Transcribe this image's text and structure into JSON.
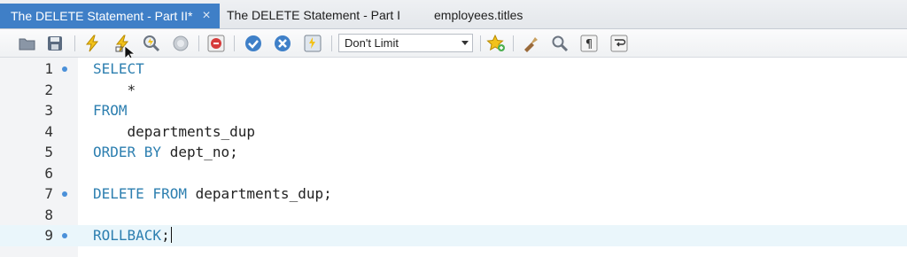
{
  "tabs": [
    {
      "label": "The DELETE Statement - Part II*",
      "active": true,
      "closable": true
    },
    {
      "label": "The DELETE Statement - Part I",
      "active": false,
      "closable": false
    },
    {
      "label": "employees.titles",
      "active": false,
      "closable": false
    }
  ],
  "toolbar": {
    "icons": [
      "open-folder-icon",
      "save-icon",
      "execute-icon",
      "execute-current-icon",
      "explain-icon",
      "stop-icon",
      "toggle-error-icon",
      "commit-icon",
      "rollback-icon",
      "autocommit-icon",
      "favorite-add-icon",
      "beautify-icon",
      "find-icon",
      "invisible-chars-icon",
      "wrap-icon"
    ],
    "limit_value": "Don't Limit"
  },
  "editor": {
    "lines": [
      {
        "num": "1",
        "marker": true,
        "kw": "SELECT",
        "text": ""
      },
      {
        "num": "2",
        "marker": false,
        "kw": "",
        "text": "    *"
      },
      {
        "num": "3",
        "marker": false,
        "kw": "FROM",
        "text": ""
      },
      {
        "num": "4",
        "marker": false,
        "kw": "",
        "text": "    departments_dup"
      },
      {
        "num": "5",
        "marker": false,
        "kw": "ORDER BY",
        "text": " dept_no;"
      },
      {
        "num": "6",
        "marker": false,
        "kw": "",
        "text": ""
      },
      {
        "num": "7",
        "marker": true,
        "kw": "DELETE FROM",
        "text": " departments_dup;"
      },
      {
        "num": "8",
        "marker": false,
        "kw": "",
        "text": ""
      },
      {
        "num": "9",
        "marker": true,
        "kw": "ROLLBACK",
        "text": ";",
        "current": true
      }
    ],
    "keyword_color": "#2d7fb0",
    "gutter_marker_color": "#4a90d9"
  },
  "colors": {
    "active_tab": "#3f7fc7",
    "current_line": "#eaf6fb"
  }
}
